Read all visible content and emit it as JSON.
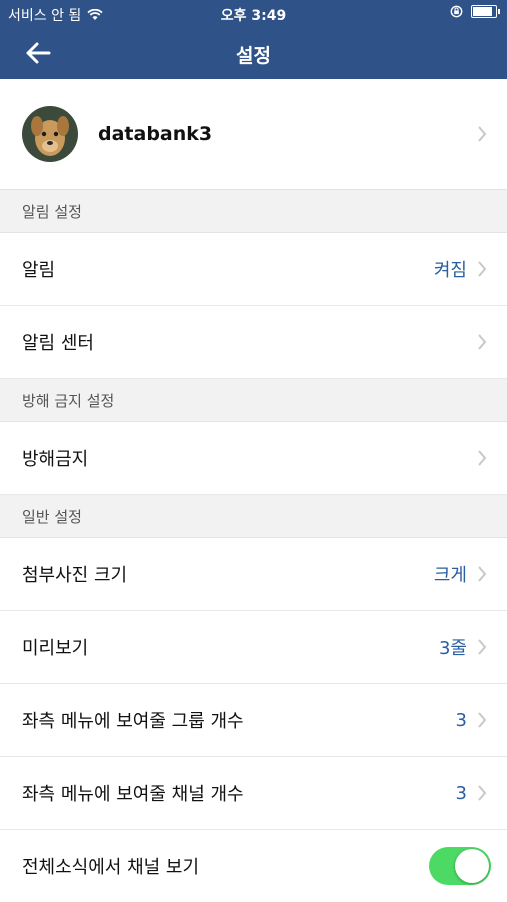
{
  "status": {
    "carrier": "서비스 안 됨",
    "time": "오후 3:49"
  },
  "nav": {
    "title": "설정"
  },
  "profile": {
    "name": "databank3"
  },
  "sections": {
    "alarm": "알림 설정",
    "dnd": "방해 금지 설정",
    "general": "일반 설정"
  },
  "rows": {
    "alarm": {
      "label": "알림",
      "value": "켜짐"
    },
    "alarm_center": {
      "label": "알림 센터"
    },
    "dnd": {
      "label": "방해금지"
    },
    "photo_size": {
      "label": "첨부사진 크기",
      "value": "크게"
    },
    "preview": {
      "label": "미리보기",
      "value": "3줄"
    },
    "group_count": {
      "label": "좌측 메뉴에 보여줄 그룹 개수",
      "value": "3"
    },
    "channel_count": {
      "label": "좌측 메뉴에 보여줄 채널 개수",
      "value": "3"
    },
    "channel_news": {
      "label": "전체소식에서 채널 보기",
      "toggle_on": true
    }
  },
  "colors": {
    "nav": "#2f5288",
    "value": "#2a5ea2",
    "toggle": "#4cd964"
  }
}
